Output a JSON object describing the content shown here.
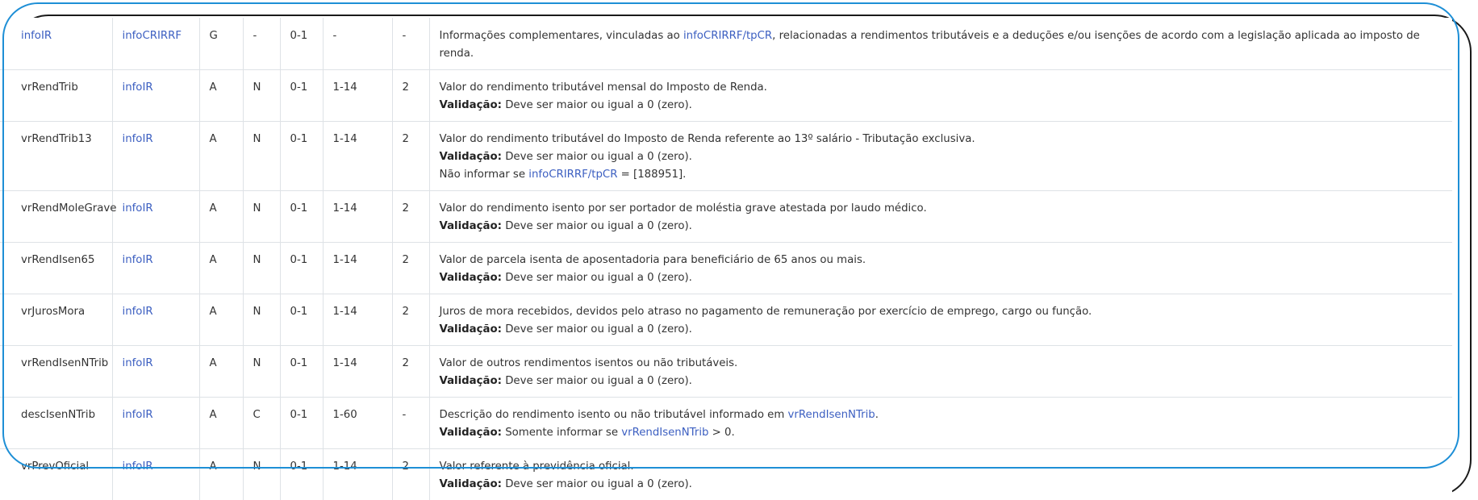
{
  "validation_label": "Validação:",
  "rows": [
    {
      "field": "infoIR",
      "field_is_link": true,
      "parent": "infoCRIRRF",
      "ele": "G",
      "tipo": "-",
      "ocor": "0-1",
      "tam": "-",
      "dec": "-",
      "desc": {
        "pre": "Informações complementares, vinculadas ao ",
        "link": "infoCRIRRF/tpCR",
        "post": ", relacionadas a rendimentos tributáveis e a deduções e/ou isenções de acordo com a legislação aplicada ao imposto de renda."
      }
    },
    {
      "field": "vrRendTrib",
      "parent": "infoIR",
      "ele": "A",
      "tipo": "N",
      "ocor": "0-1",
      "tam": "1-14",
      "dec": "2",
      "desc_text": "Valor do rendimento tributável mensal do Imposto de Renda.",
      "validation": "Deve ser maior ou igual a 0 (zero)."
    },
    {
      "field": "vrRendTrib13",
      "parent": "infoIR",
      "ele": "A",
      "tipo": "N",
      "ocor": "0-1",
      "tam": "1-14",
      "dec": "2",
      "desc_text": "Valor do rendimento tributável do Imposto de Renda referente ao 13º salário - Tributação exclusiva.",
      "validation": "Deve ser maior ou igual a 0 (zero).",
      "note_pre": "Não informar se ",
      "note_link": "infoCRIRRF/tpCR",
      "note_post": " = [188951]."
    },
    {
      "field": "vrRendMoleGrave",
      "parent": "infoIR",
      "ele": "A",
      "tipo": "N",
      "ocor": "0-1",
      "tam": "1-14",
      "dec": "2",
      "desc_text": "Valor do rendimento isento por ser portador de moléstia grave atestada por laudo médico.",
      "validation": "Deve ser maior ou igual a 0 (zero)."
    },
    {
      "field": "vrRendIsen65",
      "parent": "infoIR",
      "ele": "A",
      "tipo": "N",
      "ocor": "0-1",
      "tam": "1-14",
      "dec": "2",
      "desc_text": "Valor de parcela isenta de aposentadoria para beneficiário de 65 anos ou mais.",
      "validation": "Deve ser maior ou igual a 0 (zero)."
    },
    {
      "field": "vrJurosMora",
      "parent": "infoIR",
      "ele": "A",
      "tipo": "N",
      "ocor": "0-1",
      "tam": "1-14",
      "dec": "2",
      "desc_text": "Juros de mora recebidos, devidos pelo atraso no pagamento de remuneração por exercício de emprego, cargo ou função.",
      "validation": "Deve ser maior ou igual a 0 (zero)."
    },
    {
      "field": "vrRendIsenNTrib",
      "parent": "infoIR",
      "ele": "A",
      "tipo": "N",
      "ocor": "0-1",
      "tam": "1-14",
      "dec": "2",
      "desc_text": "Valor de outros rendimentos isentos ou não tributáveis.",
      "validation": "Deve ser maior ou igual a 0 (zero)."
    },
    {
      "field": "descIsenNTrib",
      "parent": "infoIR",
      "ele": "A",
      "tipo": "C",
      "ocor": "0-1",
      "tam": "1-60",
      "dec": "-",
      "desc_pre": "Descrição do rendimento isento ou não tributável informado em ",
      "desc_link": "vrRendIsenNTrib",
      "desc_post": ".",
      "val_pre": "Somente informar se ",
      "val_link": "vrRendIsenNTrib",
      "val_post": " > 0."
    },
    {
      "field": "vrPrevOficial",
      "parent": "infoIR",
      "ele": "A",
      "tipo": "N",
      "ocor": "0-1",
      "tam": "1-14",
      "dec": "2",
      "desc_text": "Valor referente à previdência oficial.",
      "validation": "Deve ser maior ou igual a 0 (zero)."
    }
  ]
}
